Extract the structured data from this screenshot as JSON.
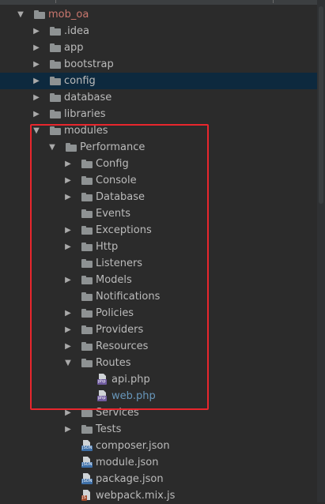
{
  "project": {
    "root_label": "mob_oa"
  },
  "tree": {
    "idea": ".idea",
    "app": "app",
    "bootstrap": "bootstrap",
    "config": "config",
    "database": "database",
    "libraries": "libraries",
    "modules": "modules",
    "performance": "Performance",
    "perf_items": {
      "config": "Config",
      "console": "Console",
      "database": "Database",
      "events": "Events",
      "exceptions": "Exceptions",
      "http": "Http",
      "listeners": "Listeners",
      "models": "Models",
      "notifications": "Notifications",
      "policies": "Policies",
      "providers": "Providers",
      "resources": "Resources",
      "routes": "Routes",
      "api_php": "api.php",
      "web_php": "web.php",
      "services": "Services",
      "tests": "Tests",
      "composer_json": "composer.json",
      "module_json": "module.json",
      "package_json": "package.json",
      "webpack_mix_js": "webpack.mix.js"
    },
    "badges": {
      "json": "JSON",
      "php": "php",
      "js": "JS"
    }
  },
  "colors": {
    "background": "#2b2b2b",
    "selected_row": "#0d293e",
    "root_text": "#c9776e",
    "link_text": "#6897bb",
    "highlight_box": "#e8262d"
  },
  "icons": {
    "expanded": "triangle-down-icon",
    "collapsed": "triangle-right-icon",
    "folder": "folder-icon",
    "file": "file-icon"
  }
}
